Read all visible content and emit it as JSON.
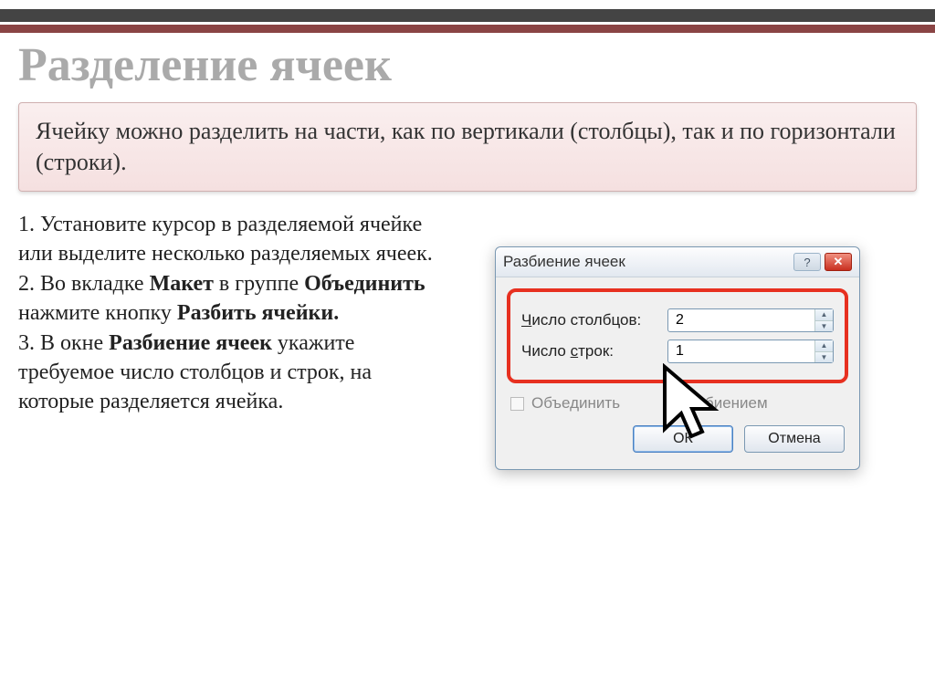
{
  "slide": {
    "title": "Разделение ячеек",
    "description": "Ячейку можно разделить на части, как по вертикали (столбцы), так и по горизонтали (строки)."
  },
  "instructions": {
    "step1_pre": "1. Установите курсор в разделяемой ячейке или выделите несколько разделяемых ячеек.",
    "step2_a": "2. Во вкладке ",
    "step2_b_bold": "Макет",
    "step2_c": " в группе ",
    "step2_d_bold": "Объединить",
    "step2_e": " нажмите кнопку ",
    "step2_f_bold": "Разбить ячейки.",
    "step3_a": "3. В окне ",
    "step3_b_bold": "Разбиение ячеек",
    "step3_c": "  укажите требуемое число столбцов и строк, на которые разделяется ячейка."
  },
  "dialog": {
    "title": "Разбиение ячеек",
    "help_symbol": "?",
    "close_symbol": "✕",
    "columns_label_u": "Ч",
    "columns_label_rest": "исло столбцов:",
    "columns_value": "2",
    "rows_label_pre": "Число ",
    "rows_label_u": "с",
    "rows_label_post": "трок:",
    "rows_value": "1",
    "merge_checkbox_pre": "Объединить ",
    "merge_checkbox_gap": "           ",
    "merge_checkbox_post": "д разбиением",
    "ok": "ОК",
    "cancel": "Отмена",
    "spin_up": "▲",
    "spin_down": "▼"
  }
}
